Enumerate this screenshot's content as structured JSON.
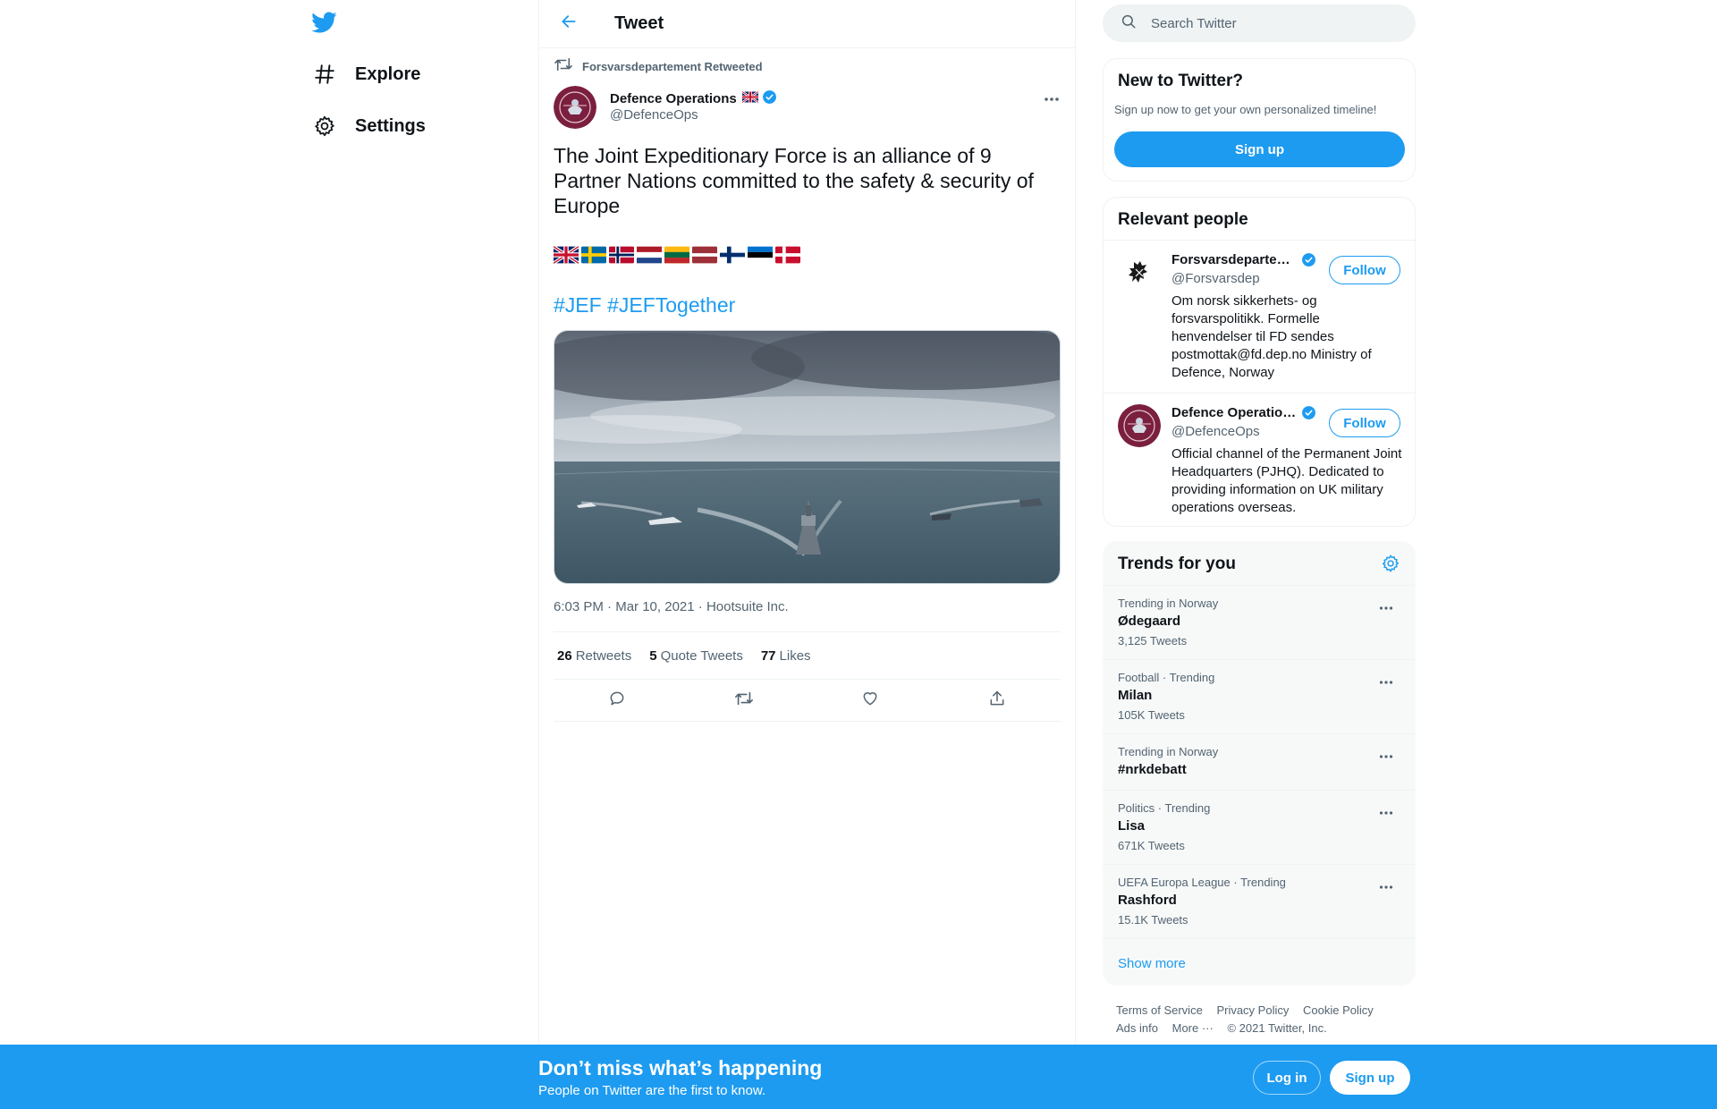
{
  "nav": {
    "explore_label": "Explore",
    "settings_label": "Settings"
  },
  "header": {
    "title": "Tweet"
  },
  "tweet": {
    "retweeted_by": "Forsvarsdepartement Retweeted",
    "author_name": "Defence Operations",
    "author_handle": "@DefenceOps",
    "text": "The Joint Expeditionary Force is an alliance of 9 Partner Nations committed to the safety & security of Europe",
    "flags": [
      "united-kingdom-flag",
      "sweden-flag",
      "norway-flag",
      "netherlands-flag",
      "lithuania-flag",
      "latvia-flag",
      "finland-flag",
      "estonia-flag",
      "denmark-flag"
    ],
    "hashtags": [
      "#JEF",
      "#JEFTogether"
    ],
    "time": "6:03 PM",
    "date": "Mar 10, 2021",
    "source": "Hootsuite Inc.",
    "separator": "·",
    "stats": {
      "retweets_count": "26",
      "retweets_label": "Retweets",
      "quotes_count": "5",
      "quotes_label": "Quote Tweets",
      "likes_count": "77",
      "likes_label": "Likes"
    }
  },
  "search": {
    "placeholder": "Search Twitter"
  },
  "new_to_twitter": {
    "title": "New to Twitter?",
    "subtitle": "Sign up now to get your own personalized timeline!",
    "button": "Sign up"
  },
  "relevant_people": {
    "title": "Relevant people",
    "people": [
      {
        "name": "Forsvarsdepartementet",
        "handle": "@Forsvarsdep",
        "bio": "Om norsk sikkerhets- og forsvarspolitikk. Formelle henvendelser til FD sendes postmottak@fd.dep.no Ministry of Defence, Norway",
        "follow_label": "Follow"
      },
      {
        "name": "Defence Operations",
        "handle": "@DefenceOps",
        "bio": "Official channel of the Permanent Joint Headquarters (PJHQ). Dedicated to providing information on UK military operations overseas.",
        "follow_label": "Follow"
      }
    ]
  },
  "trends": {
    "title": "Trends for you",
    "items": [
      {
        "context": "Trending in Norway",
        "name": "Ødegaard",
        "count": "3,125 Tweets"
      },
      {
        "context": "Football · Trending",
        "name": "Milan",
        "count": "105K Tweets"
      },
      {
        "context": "Trending in Norway",
        "name": "#nrkdebatt",
        "count": ""
      },
      {
        "context": "Politics · Trending",
        "name": "Lisa",
        "count": "671K Tweets"
      },
      {
        "context": "UEFA Europa League · Trending",
        "name": "Rashford",
        "count": "15.1K Tweets"
      }
    ],
    "show_more": "Show more"
  },
  "footer": {
    "terms": "Terms of Service",
    "privacy": "Privacy Policy",
    "cookie": "Cookie Policy",
    "ads": "Ads info",
    "more": "More ···",
    "copyright": "© 2021 Twitter, Inc."
  },
  "bottom_bar": {
    "title": "Don’t miss what’s happening",
    "subtitle": "People on Twitter are the first to know.",
    "login": "Log in",
    "signup": "Sign up"
  },
  "colors": {
    "accent": "#1d9bf0",
    "text_primary": "#0f1419",
    "text_secondary": "#536471",
    "border": "#eff3f4"
  }
}
